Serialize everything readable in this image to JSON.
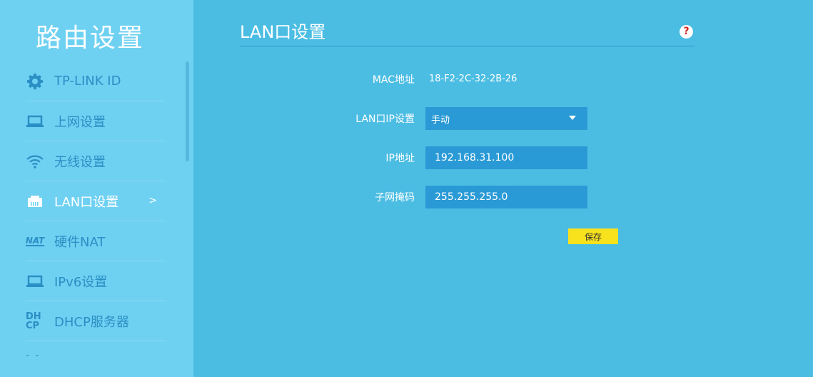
{
  "sidebar": {
    "title": "路由设置",
    "items": [
      {
        "label": "TP-LINK ID",
        "icon": "gear-icon"
      },
      {
        "label": "上网设置",
        "icon": "laptop-icon"
      },
      {
        "label": "无线设置",
        "icon": "wifi-icon"
      },
      {
        "label": "LAN口设置",
        "icon": "ethernet-port-icon",
        "active": true,
        "arrow": ">"
      },
      {
        "label": "硬件NAT",
        "icon": "nat-icon",
        "icon_text": "NAT"
      },
      {
        "label": "IPv6设置",
        "icon": "laptop-icon"
      },
      {
        "label": "DHCP服务器",
        "icon": "dhcp-icon",
        "icon_text_1": "DH",
        "icon_text_2": "CP"
      }
    ],
    "more": "- -"
  },
  "main": {
    "title": "LAN口设置",
    "help": "?",
    "form": {
      "mac_label": "MAC地址",
      "mac_value": "18-F2-2C-32-2B-26",
      "lan_ip_label": "LAN口IP设置",
      "lan_ip_value": "手动",
      "ip_label": "IP地址",
      "ip_value": "192.168.31.100",
      "mask_label": "子网掩码",
      "mask_value": "255.255.255.0",
      "save_label": "保存"
    }
  },
  "colors": {
    "main_bg": "#4bbde3",
    "sidebar_bg": "#6fd1f2",
    "field_bg": "#2a9ad6",
    "save_button": "#f7e21d",
    "nav_text": "#2a8fc4"
  }
}
